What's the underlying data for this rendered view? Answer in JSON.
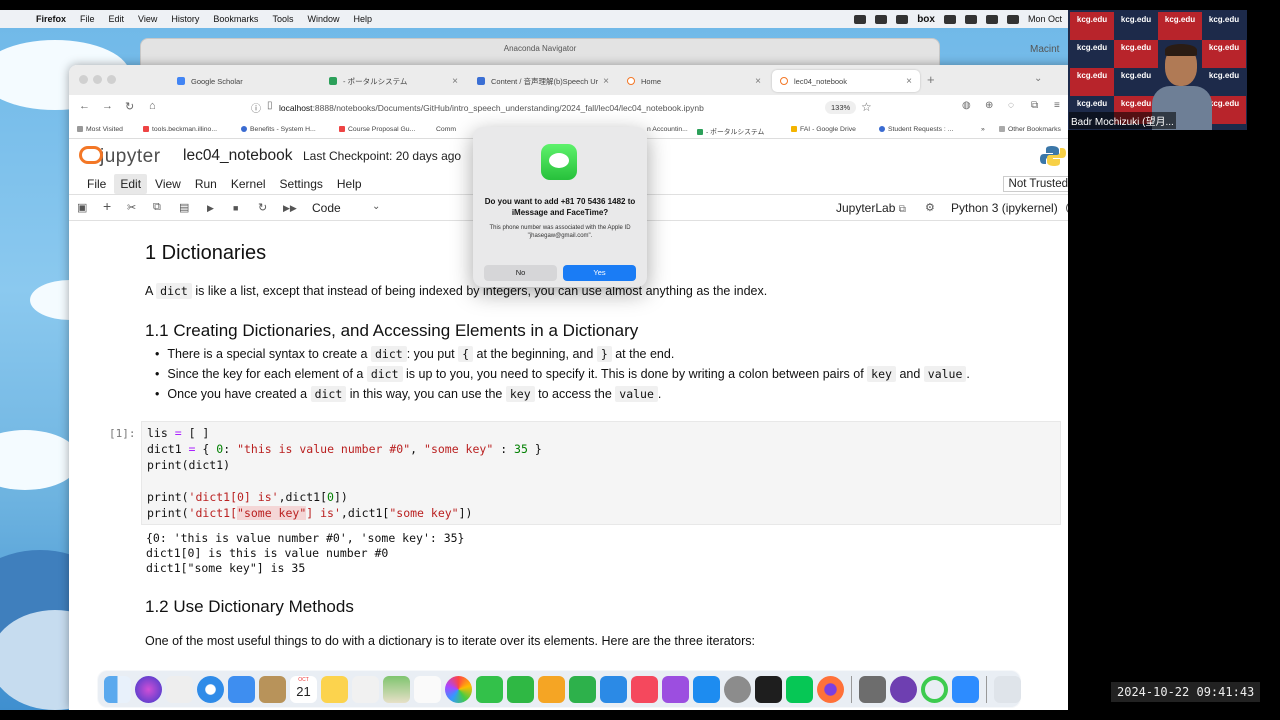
{
  "menubar": {
    "app": "Firefox",
    "items": [
      "File",
      "Edit",
      "View",
      "History",
      "Bookmarks",
      "Tools",
      "Window",
      "Help"
    ],
    "box_label": "box",
    "clock": "Mon Oct"
  },
  "background_windows": {
    "anaconda_title": "Anaconda Navigator",
    "side_label": "Macint"
  },
  "browser": {
    "tabs": [
      {
        "label": "Google Scholar",
        "favicon_color": "#4285f4"
      },
      {
        "label": "- ポータルシステム",
        "favicon_color": "#2ca05a"
      },
      {
        "label": "Content / 音声理解(b)Speech Ur",
        "favicon_color": "#3b6fd4"
      },
      {
        "label": "Home",
        "favicon_color": "#f37726"
      },
      {
        "label": "lec04_notebook",
        "favicon_color": "#f37726"
      }
    ],
    "url_host": "localhost",
    "url_path": ":8888/notebooks/Documents/GitHub/intro_speech_understanding/2024_fall/lec04/lec04_notebook.ipynb",
    "zoom": "133%",
    "bookmarks": [
      "Most Visited",
      "tools.beckman.illino...",
      "Benefits - System H...",
      "Course Proposal Gu...",
      "Comm",
      "n Accountin...",
      "- ポータルシステム",
      "FAI - Google Drive",
      "Student Requests : ...",
      "Other Bookmarks"
    ]
  },
  "jupyter": {
    "logo_text": "jupyter",
    "notebook_name": "lec04_notebook",
    "checkpoint": "Last Checkpoint: 20 days ago",
    "menu": [
      "File",
      "Edit",
      "View",
      "Run",
      "Kernel",
      "Settings",
      "Help"
    ],
    "trusted": "Not Trusted",
    "cell_type": "Code",
    "jupyterlab_link": "JupyterLab",
    "kernel_name": "Python 3 (ipykernel)",
    "accent": "#f37726"
  },
  "notebook": {
    "h1": "1 Dictionaries",
    "intro_pre": "A",
    "intro_code": "dict",
    "intro_post": "is like a list, except that instead of being indexed by integers, you can use almost anything as the index.",
    "h2a": "1.1 Creating Dictionaries, and Accessing Elements in a Dictionary",
    "bullets": {
      "b1_a": "There is a special syntax to create a",
      "b1_code1": "dict",
      "b1_b": ": you put",
      "b1_code2": "{",
      "b1_c": "at the beginning, and",
      "b1_code3": "}",
      "b1_d": "at the end.",
      "b2_a": "Since the key for each element of a",
      "b2_code1": "dict",
      "b2_b": "is up to you, you need to specify it. This is done by writing a colon between pairs of",
      "b2_code2": "key",
      "b2_c": "and",
      "b2_code3": "value",
      "b2_d": ".",
      "b3_a": "Once you have created a",
      "b3_code1": "dict",
      "b3_b": "in this way, you can use the",
      "b3_code2": "key",
      "b3_c": "to access the",
      "b3_code3": "value",
      "b3_d": "."
    },
    "prompt": "[1]:",
    "code": {
      "l1a": "lis ",
      "l1op": "=",
      "l1b": " [ ]",
      "l2a": "dict1 ",
      "l2op": "=",
      "l2b": " { ",
      "l2n0": "0",
      "l2c": ": ",
      "l2s1": "\"this is value number #0\"",
      "l2d": ", ",
      "l2s2": "\"some key\"",
      "l2e": " : ",
      "l2n35": "35",
      "l2f": " }",
      "l3": "print(dict1)",
      "l5a": "print(",
      "l5s": "'dict1[0] is'",
      "l5b": ",dict1[",
      "l5n": "0",
      "l5c": "])",
      "l6a": "print(",
      "l6s1": "'dict1[",
      "l6hl": "\"some key\"",
      "l6s2": "] is'",
      "l6b": ",dict1[",
      "l6s3": "\"some key\"",
      "l6c": "])"
    },
    "output": "{0: 'this is value number #0', 'some key': 35}\ndict1[0] is this is value number #0\ndict1[\"some key\"] is 35",
    "h2b": "1.2 Use Dictionary Methods",
    "para2": "One of the most useful things to do with a dictionary is to iterate over its elements. Here are the three iterators:"
  },
  "dialog": {
    "title": "Do you want to add +81 70 5436 1482 to iMessage and FaceTime?",
    "body": "This phone number was associated with the Apple ID \"jhasegaw@gmail.com\".",
    "no": "No",
    "yes": "Yes",
    "yes_color": "#1a7cf5"
  },
  "dock": {
    "calendar_day": "21",
    "calendar_month": "OCT",
    "apps": [
      "finder-icon",
      "siri-icon",
      "launchpad-icon",
      "safari-icon",
      "mail-icon",
      "notes-brown-icon",
      "calendar-icon",
      "stickies-icon",
      "news-icon",
      "maps-icon",
      "reminders-icon",
      "photos-icon",
      "messages-icon",
      "facetime-icon",
      "pages-icon",
      "numbers-icon",
      "keynote-icon",
      "music-icon",
      "podcasts-icon",
      "appstore-icon",
      "settings-icon",
      "terminal-icon",
      "line-icon",
      "firefox-icon",
      "gimp-icon",
      "github-icon",
      "activity-ring-icon",
      "zoom-icon",
      "trash-icon"
    ]
  },
  "webcam": {
    "name": "Badr Mochizuki (望月...",
    "backdrop_text": "kcg.edu"
  },
  "timestamp": "2024-10-22 09:41:43"
}
